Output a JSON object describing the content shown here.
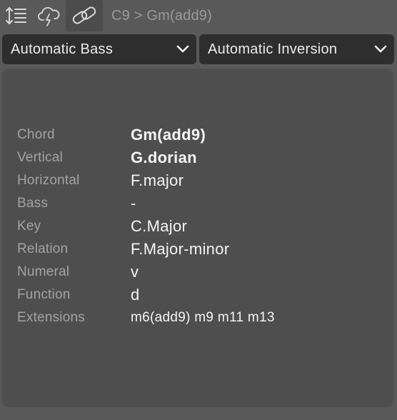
{
  "toolbar": {
    "icons": [
      "line-spacing-icon",
      "cloud-lightning-icon",
      "link-icon"
    ],
    "breadcrumb": "C9 > Gm(add9)"
  },
  "dropdowns": {
    "bass": "Automatic Bass",
    "inversion": "Automatic Inversion"
  },
  "info": {
    "rows": [
      {
        "label": "Chord",
        "value": "Gm(add9)"
      },
      {
        "label": "Vertical",
        "value": "G.dorian"
      },
      {
        "label": "Horizontal",
        "value": "F.major"
      },
      {
        "label": "Bass",
        "value": "-"
      },
      {
        "label": "Key",
        "value": "C.Major"
      },
      {
        "label": "Relation",
        "value": "F.Major-minor"
      },
      {
        "label": "Numeral",
        "value": "v"
      },
      {
        "label": "Function",
        "value": "d"
      },
      {
        "label": "Extensions",
        "value": "m6(add9) m9 m11 m13"
      }
    ]
  },
  "colors": {
    "background": "#595959",
    "panel": "#4e4e4e",
    "select": "#2e2e2e",
    "label": "#a3a3a3",
    "value": "#f4f4f4"
  }
}
